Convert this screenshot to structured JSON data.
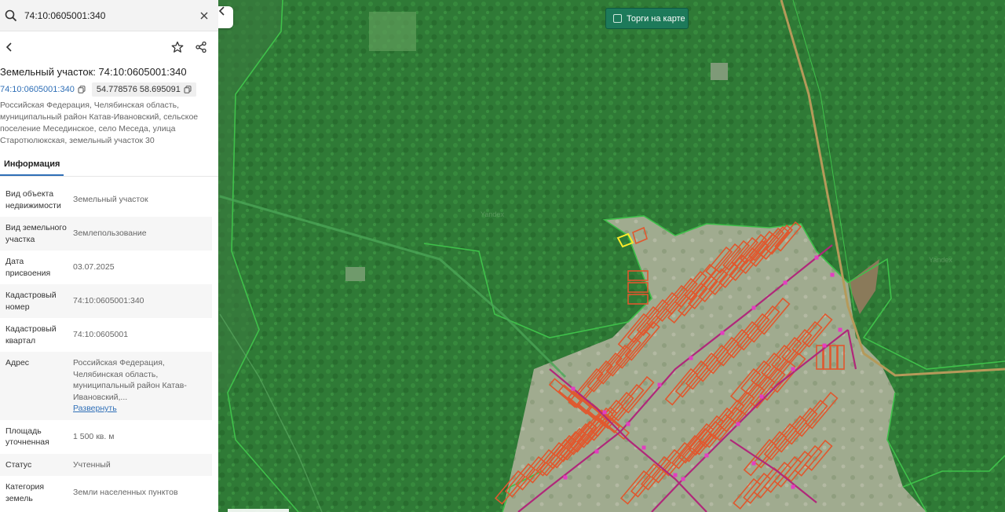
{
  "search": {
    "value": "74:10:0605001:340",
    "placeholder": ""
  },
  "card": {
    "title": "Земельный участок: 74:10:0605001:340",
    "cadastral_number": "74:10:0605001:340",
    "coordinates": "54.778576 58.695091",
    "address": "Российская Федерация, Челябинская область, муниципальный район Катав-Ивановский, сельское поселение Месединское, село Меседа, улица Старотюлюкская, земельный участок 30"
  },
  "tabs": [
    {
      "label": "Информация",
      "active": true
    }
  ],
  "properties": [
    {
      "key": "Вид объекта недвижимости",
      "value": "Земельный участок"
    },
    {
      "key": "Вид земельного участка",
      "value": "Землепользование"
    },
    {
      "key": "Дата присвоения",
      "value": "03.07.2025"
    },
    {
      "key": "Кадастровый номер",
      "value": "74:10:0605001:340"
    },
    {
      "key": "Кадастровый квартал",
      "value": "74:10:0605001"
    },
    {
      "key": "Адрес",
      "value": "Российская Федерация, Челябинская область, муниципальный район Катав-Ивановский,...",
      "link": "Развернуть"
    },
    {
      "key": "Площадь уточненная",
      "value": "1 500 кв. м"
    },
    {
      "key": "Статус",
      "value": "Учтенный"
    },
    {
      "key": "Категория земель",
      "value": "Земли населенных пунктов"
    }
  ],
  "map": {
    "auction_label": "Торги на карте",
    "colors": {
      "forest": "#2e7a35",
      "forest_dark": "#24662b",
      "village": "#9aa88a",
      "parcel_stroke": "#e0582e",
      "selected_parcel": "#ffea2a",
      "boundary": "#3fc04a",
      "road": "#b59a5a",
      "power_line": "#b0287a",
      "accent_button": "#1d7a5a"
    },
    "icons": [
      "search-icon",
      "close-icon",
      "chevron-left-icon",
      "star-icon",
      "share-icon",
      "copy-icon"
    ]
  }
}
